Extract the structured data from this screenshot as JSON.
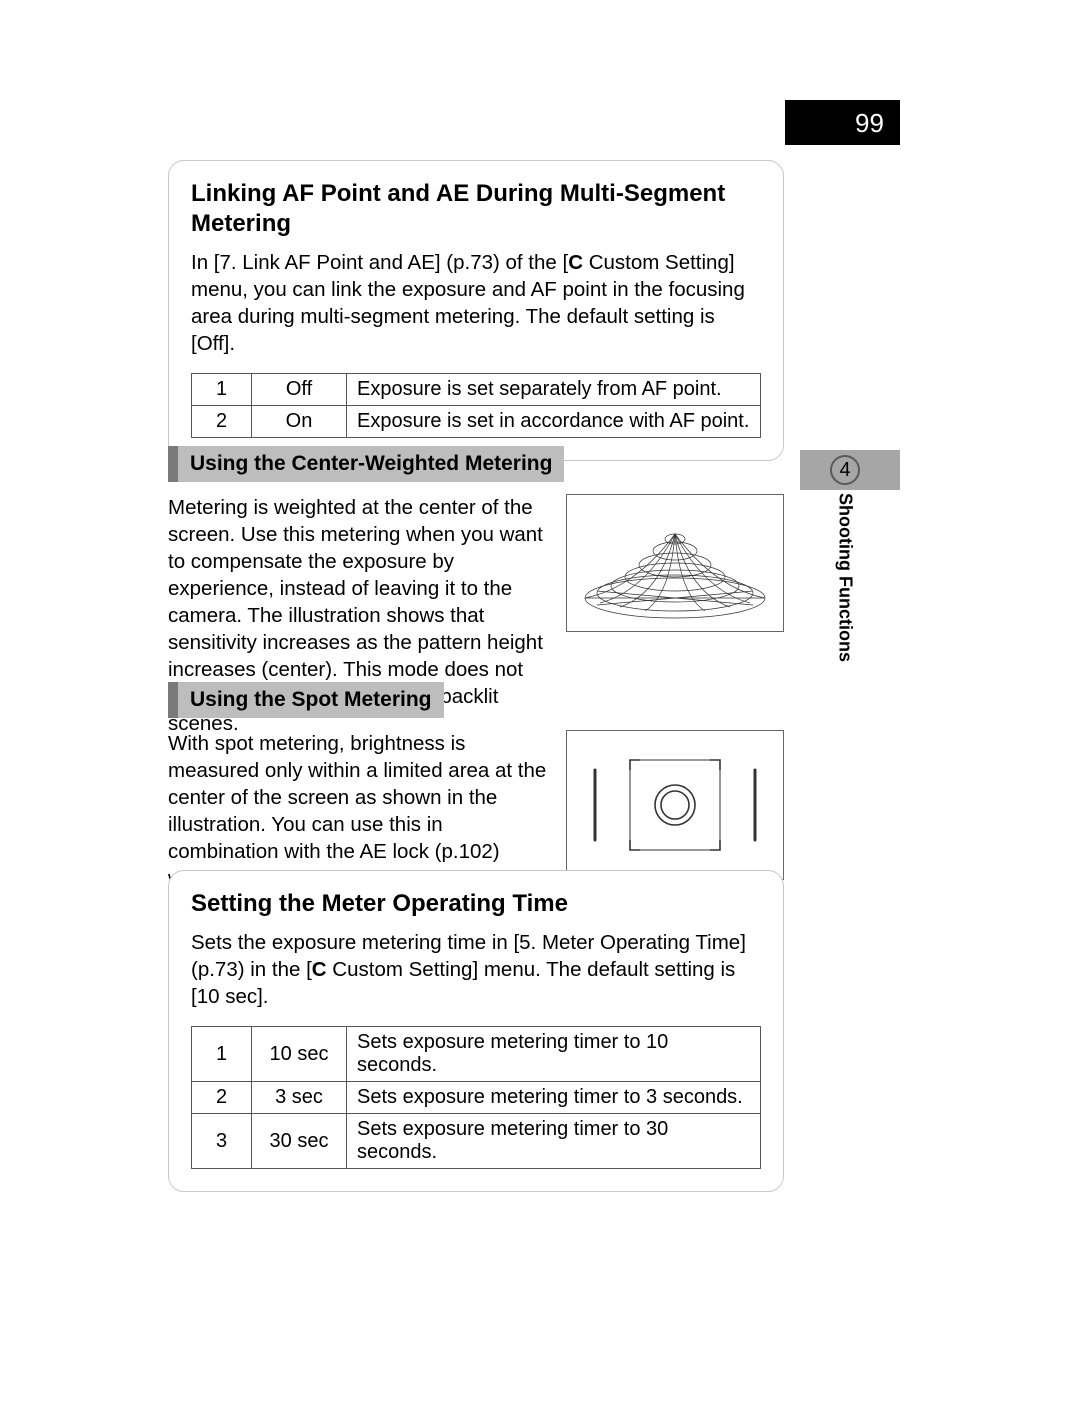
{
  "page_number": "99",
  "chapter": {
    "number": "4",
    "label": "Shooting Functions"
  },
  "box1": {
    "title": "Linking AF Point and AE During Multi-Segment Metering",
    "desc_pre": "In [7. Link AF Point and AE] (p.73) of the [",
    "desc_sym": "C",
    "desc_post": " Custom Setting] menu, you can link the exposure and AF point in the focusing area during multi-segment metering. The default setting is [Off].",
    "rows": [
      {
        "n": "1",
        "v": "Off",
        "d": "Exposure is set separately from AF point."
      },
      {
        "n": "2",
        "v": "On",
        "d": "Exposure is set in accordance with AF point."
      }
    ]
  },
  "center_weighted": {
    "heading": "Using the Center-Weighted Metering",
    "text": "Metering is weighted at the center of the screen. Use this metering when you want to compensate the exposure by experience, instead of leaving it to the camera. The illustration shows that sensitivity increases as the pattern height increases (center). This mode does not automatically compensate for backlit scenes."
  },
  "spot": {
    "heading": "Using the Spot Metering",
    "text": "With spot metering, brightness is measured only within a limited area at the center of the screen as shown in the illustration. You can use this in combination with the AE lock (p.102) when the subject is extremely small and proper exposure is difficult to obtain."
  },
  "box2": {
    "title": "Setting the Meter Operating Time",
    "desc_pre": "Sets the exposure metering time in [5. Meter Operating Time] (p.73) in the [",
    "desc_sym": "C",
    "desc_post": " Custom Setting] menu. The default setting is [10 sec].",
    "rows": [
      {
        "n": "1",
        "v": "10 sec",
        "d": "Sets exposure metering timer to 10 seconds."
      },
      {
        "n": "2",
        "v": "3 sec",
        "d": "Sets exposure metering timer to 3 seconds."
      },
      {
        "n": "3",
        "v": "30 sec",
        "d": "Sets exposure metering timer to 30 seconds."
      }
    ]
  }
}
